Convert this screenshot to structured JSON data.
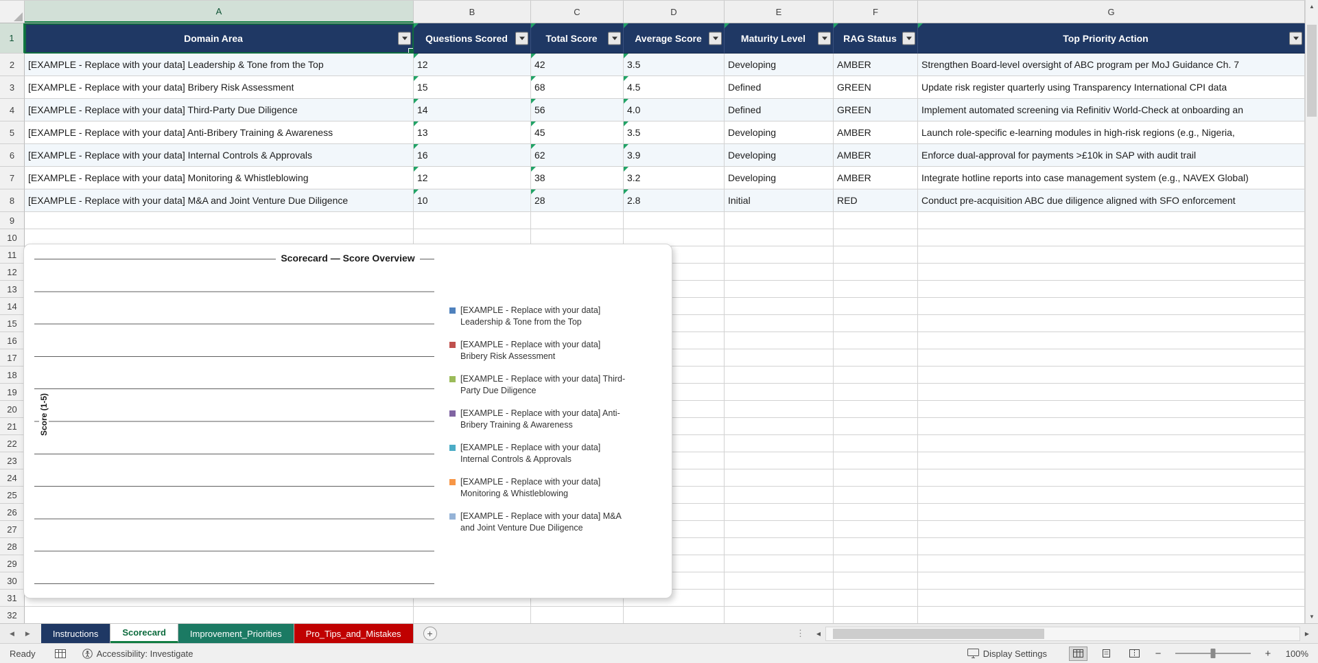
{
  "grid": {
    "column_letters": [
      "A",
      "B",
      "C",
      "D",
      "E",
      "F",
      "G"
    ],
    "row_numbers": [
      "1",
      "2",
      "3",
      "4",
      "5",
      "6",
      "7",
      "8",
      "9",
      "10",
      "11",
      "12",
      "13",
      "14",
      "15",
      "16",
      "17",
      "18",
      "19",
      "20",
      "21",
      "22",
      "23",
      "24",
      "25",
      "26",
      "27",
      "28",
      "29",
      "30",
      "31",
      "32"
    ],
    "selected_cell": "A1"
  },
  "table": {
    "header": [
      "Domain Area",
      "Questions Scored",
      "Total Score",
      "Average Score",
      "Maturity Level",
      "RAG Status",
      "Top Priority Action"
    ],
    "rows": [
      [
        "[EXAMPLE - Replace with your data] Leadership & Tone from the Top",
        "12",
        "42",
        "3.5",
        "Developing",
        "AMBER",
        "Strengthen Board-level oversight of ABC program per MoJ Guidance Ch. 7"
      ],
      [
        "[EXAMPLE - Replace with your data] Bribery Risk Assessment",
        "15",
        "68",
        "4.5",
        "Defined",
        "GREEN",
        "Update risk register quarterly using Transparency International CPI data"
      ],
      [
        "[EXAMPLE - Replace with your data] Third-Party Due Diligence",
        "14",
        "56",
        "4.0",
        "Defined",
        "GREEN",
        "Implement automated screening via Refinitiv World-Check at onboarding an"
      ],
      [
        "[EXAMPLE - Replace with your data] Anti-Bribery Training & Awareness",
        "13",
        "45",
        "3.5",
        "Developing",
        "AMBER",
        "Launch role-specific e-learning modules in high-risk regions (e.g., Nigeria,"
      ],
      [
        "[EXAMPLE - Replace with your data] Internal Controls & Approvals",
        "16",
        "62",
        "3.9",
        "Developing",
        "AMBER",
        "Enforce dual-approval for payments >£10k in SAP with audit trail"
      ],
      [
        "[EXAMPLE - Replace with your data] Monitoring & Whistleblowing",
        "12",
        "38",
        "3.2",
        "Developing",
        "AMBER",
        "Integrate hotline reports into case management system (e.g., NAVEX Global)"
      ],
      [
        "[EXAMPLE - Replace with your data] M&A and Joint Venture Due Diligence",
        "10",
        "28",
        "2.8",
        "Initial",
        "RED",
        "Conduct pre-acquisition ABC due diligence aligned with SFO enforcement"
      ]
    ]
  },
  "chart": {
    "type": "column",
    "title": "Scorecard — Score Overview",
    "y_axis_label": "Score (1-5)",
    "value_axis_range": [
      0,
      5
    ],
    "gridline_count": 11,
    "series_values_visible": false,
    "legend": [
      {
        "label": "[EXAMPLE - Replace with your data] Leadership & Tone from the Top",
        "color": "#4F81BD"
      },
      {
        "label": "[EXAMPLE - Replace with your data] Bribery Risk Assessment",
        "color": "#C0504D"
      },
      {
        "label": "[EXAMPLE - Replace with your data] Third-Party Due Diligence",
        "color": "#9BBB59"
      },
      {
        "label": "[EXAMPLE - Replace with your data] Anti-Bribery Training & Awareness",
        "color": "#8064A2"
      },
      {
        "label": "[EXAMPLE - Replace with your data] Internal Controls & Approvals",
        "color": "#4BACC6"
      },
      {
        "label": "[EXAMPLE - Replace with your data] Monitoring & Whistleblowing",
        "color": "#F79646"
      },
      {
        "label": "[EXAMPLE - Replace with your data] M&A and Joint Venture Due Diligence",
        "color": "#95B3D7"
      }
    ]
  },
  "tabs": [
    {
      "label": "Instructions",
      "bg": "#1F3864",
      "active": false
    },
    {
      "label": "Scorecard",
      "bg": "#FFFFFF",
      "active": true
    },
    {
      "label": "Improvement_Priorities",
      "bg": "#1B7A63",
      "active": false
    },
    {
      "label": "Pro_Tips_and_Mistakes",
      "bg": "#C00000",
      "active": false
    }
  ],
  "statusbar": {
    "ready": "Ready",
    "accessibility": "Accessibility: Investigate",
    "display_settings": "Display Settings",
    "zoom": "100%"
  },
  "icons": {
    "add_sheet": "+",
    "more_dots": "⋮",
    "tab_nav_left": "◀",
    "tab_nav_right": "▶",
    "scroll_left": "◀",
    "scroll_right": "▶",
    "scroll_up": "▲",
    "scroll_down": "▼"
  },
  "colors": {
    "table_header_bg": "#1F3864",
    "selection_green": "#0F6B3F",
    "error_indicator_green": "#21A366",
    "band_row": "#F2F7FB"
  }
}
